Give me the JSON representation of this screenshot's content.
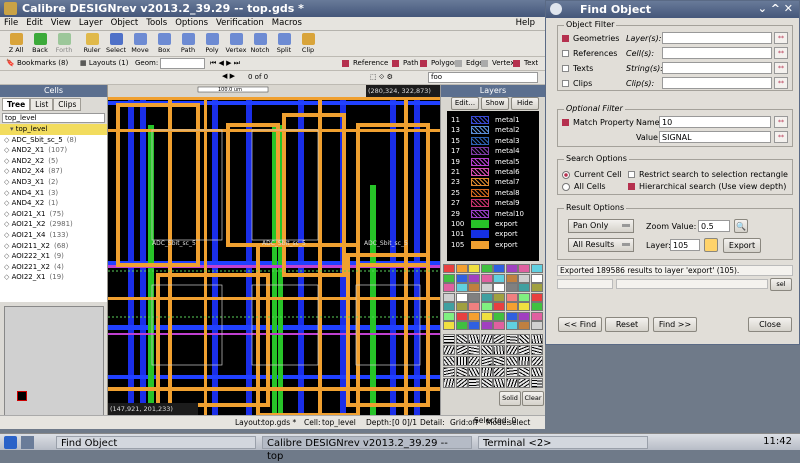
{
  "app": {
    "title": "Calibre DESIGNrev v2013.2_39.29  --  top.gds *",
    "menu": [
      "File",
      "Edit",
      "View",
      "Layer",
      "Object",
      "Tools",
      "Options",
      "Verification",
      "Macros"
    ],
    "help": "Help",
    "toolbar": [
      "Z All",
      "Back",
      "Forth",
      "Ruler",
      "Select",
      "Move",
      "Box",
      "Path",
      "Poly",
      "Vertex",
      "Notch",
      "Split",
      "Clip"
    ],
    "bookmarks": "Bookmarks (8)",
    "layouts": "Layouts (1)",
    "geom_label": "Geom:",
    "page_count": "0 of 0",
    "filters": [
      "Reference",
      "Path",
      "Polygon",
      "Edge",
      "Vertex",
      "Text"
    ],
    "foo": "foo",
    "cells_header": "Cells",
    "cell_tabs": [
      "Tree",
      "List",
      "Clips"
    ],
    "cell_filter": "top_level",
    "cells": [
      {
        "name": "top_level",
        "count": ""
      },
      {
        "name": "ADC_Sbit_sc_5",
        "count": "(8)"
      },
      {
        "name": "AND2_X1",
        "count": "(107)"
      },
      {
        "name": "AND2_X2",
        "count": "(5)"
      },
      {
        "name": "AND2_X4",
        "count": "(87)"
      },
      {
        "name": "AND3_X1",
        "count": "(2)"
      },
      {
        "name": "AND4_X1",
        "count": "(3)"
      },
      {
        "name": "AND4_X2",
        "count": "(1)"
      },
      {
        "name": "AOI21_X1",
        "count": "(75)"
      },
      {
        "name": "AOI21_X2",
        "count": "(2981)"
      },
      {
        "name": "AOI21_X4",
        "count": "(133)"
      },
      {
        "name": "AOI211_X2",
        "count": "(68)"
      },
      {
        "name": "AOI222_X1",
        "count": "(9)"
      },
      {
        "name": "AOI221_X2",
        "count": "(4)"
      },
      {
        "name": "AOI22_X1",
        "count": "(19)"
      }
    ],
    "ruler_label": "100.0 um",
    "coords_top": "(280,324, 322,873)",
    "coords_bottom": "(147,921, 201,233)",
    "cell_label": "ADC_Sbit_sc_5",
    "layers_header": "Layers",
    "layer_buttons": [
      "Edit...",
      "Show",
      "Hide"
    ],
    "layers": [
      {
        "num": "11",
        "name": "metal1",
        "color": "#3a4bd6"
      },
      {
        "num": "13",
        "name": "metal2",
        "color": "#5b8fd9"
      },
      {
        "num": "15",
        "name": "metal3",
        "color": "#2d63b5"
      },
      {
        "num": "17",
        "name": "metal4",
        "color": "#7f3ca8"
      },
      {
        "num": "19",
        "name": "metal5",
        "color": "#b73fd1"
      },
      {
        "num": "21",
        "name": "metal6",
        "color": "#d94eb4"
      },
      {
        "num": "23",
        "name": "metal7",
        "color": "#e18a2e"
      },
      {
        "num": "25",
        "name": "metal8",
        "color": "#d66a1f"
      },
      {
        "num": "27",
        "name": "metal9",
        "color": "#c7326b"
      },
      {
        "num": "29",
        "name": "metal10",
        "color": "#9b3fc9"
      },
      {
        "num": "100",
        "name": "export",
        "color": "#27c428"
      },
      {
        "num": "101",
        "name": "export",
        "color": "#1530e0"
      },
      {
        "num": "105",
        "name": "export",
        "color": "#f0a030"
      }
    ],
    "pattern_buttons": [
      "Solid",
      "Clear"
    ],
    "status": {
      "layout_label": "Layout:",
      "layout": "top.gds *",
      "cell_label": "Cell:",
      "cell": "top_level",
      "depth_label": "Depth:",
      "depth": "[0 0]/1",
      "detail_label": "Detail:",
      "grid_label": "Grid:",
      "grid": "off",
      "mode_label": "Mode:",
      "mode": "select",
      "selected_label": "Selected:",
      "selected": "0"
    }
  },
  "dialog": {
    "title": "Find Object",
    "object_filter_label": "Object Filter",
    "filters": [
      {
        "label": "Geometries",
        "field_label": "Layer(s):",
        "value": "",
        "checked": true
      },
      {
        "label": "References",
        "field_label": "Cell(s):",
        "value": "",
        "checked": false
      },
      {
        "label": "Texts",
        "field_label": "String(s):",
        "value": "",
        "checked": false
      },
      {
        "label": "Clips",
        "field_label": "Clip(s):",
        "value": "",
        "checked": false
      }
    ],
    "dd_label": "**",
    "optional_filter_label": "Optional Filter",
    "match_property": "Match Property",
    "name_label": "Name",
    "name_value": "10",
    "value_label": "Value",
    "value_value": "SIGNAL",
    "search_options_label": "Search Options",
    "current_cell": "Current Cell",
    "all_cells": "All Cells",
    "restrict": "Restrict search to selection rectangle",
    "hierarchical": "Hierarchical search (Use view depth)",
    "result_options_label": "Result Options",
    "pan_only": "Pan Only",
    "zoom_label": "Zoom Value:",
    "zoom_value": "0.5",
    "all_results": "All Results",
    "layer_label": "Layer:",
    "layer_value": "105",
    "export_button": "Export",
    "message": "Exported 189586 results to layer 'export' (105).",
    "sel_button": "sel",
    "find_prev": "<< Find",
    "reset": "Reset",
    "find_next": "Find >>",
    "close": "Close"
  },
  "taskbar": {
    "items": [
      "Find Object",
      "Calibre DESIGNrev v2013.2_39.29  --  top",
      "Terminal <2>"
    ],
    "time": "11:42"
  }
}
